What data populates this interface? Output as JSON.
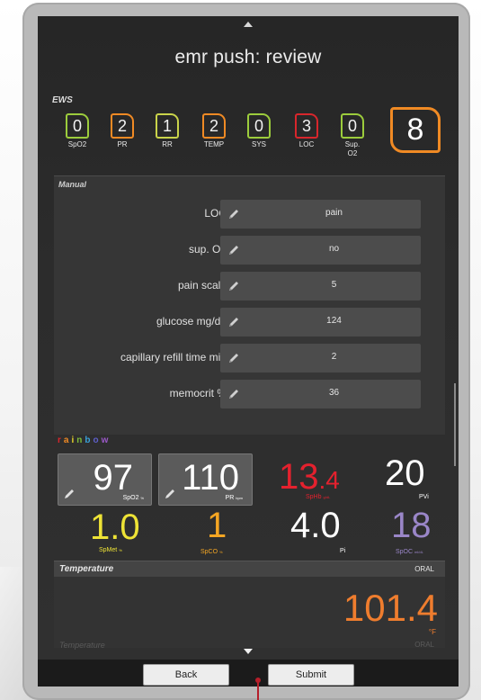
{
  "screen": {
    "title": "emr push: review"
  },
  "ews": {
    "label": "EWS",
    "items": [
      {
        "value": "0",
        "name": "SpO2",
        "color": "#9ccc3c"
      },
      {
        "value": "2",
        "name": "PR",
        "color": "#f08a24"
      },
      {
        "value": "1",
        "name": "RR",
        "color": "#c9d34a"
      },
      {
        "value": "2",
        "name": "TEMP",
        "color": "#f08a24"
      },
      {
        "value": "0",
        "name": "SYS",
        "color": "#9ccc3c"
      },
      {
        "value": "3",
        "name": "LOC",
        "color": "#d8262c"
      },
      {
        "value": "0",
        "name": "Sup.",
        "name2": "O2",
        "color": "#9ccc3c"
      }
    ],
    "total": "8",
    "total_color": "#f08a24"
  },
  "manual": {
    "label": "Manual",
    "rows": [
      {
        "label": "LOC",
        "value": "pain"
      },
      {
        "label": "sup. O2",
        "value": "no"
      },
      {
        "label": "pain scale",
        "value": "5"
      },
      {
        "label": "glucose mg/dL",
        "value": "124"
      },
      {
        "label": "capillary refill time  min",
        "value": "2"
      },
      {
        "label": "memocrit %",
        "value": "36"
      }
    ]
  },
  "rainbow": {
    "letters": [
      "r",
      "a",
      "i",
      "n",
      "b",
      "o",
      "w"
    ],
    "colors": [
      "#d8262c",
      "#f08a24",
      "#e6d32a",
      "#7dbb3a",
      "#3aa0d8",
      "#5e5fc9",
      "#9b59c9"
    ],
    "params": [
      {
        "value": "97",
        "label": "SpO2",
        "unit": "%",
        "color": "#ffffff"
      },
      {
        "value": "110",
        "label": "PR",
        "unit": "bpm",
        "color": "#ffffff"
      },
      {
        "value": "13",
        "decimal": ".4",
        "label": "SpHb",
        "unit": "g/dL",
        "color": "#e4212e"
      },
      {
        "value": "20",
        "label": "PVi",
        "unit": "",
        "color": "#ffffff"
      },
      {
        "value": "1.0",
        "label": "SpMet",
        "unit": "%",
        "color": "#eee336"
      },
      {
        "value": "1",
        "label": "SpCO",
        "unit": "%",
        "color": "#f5a623"
      },
      {
        "value": "4.0",
        "label": "Pi",
        "unit": "",
        "color": "#ffffff"
      },
      {
        "value": "18",
        "label": "SpOC",
        "unit": "ml/dL",
        "color": "#9a86c8"
      }
    ]
  },
  "temperature": {
    "title": "Temperature",
    "site": "ORAL",
    "value": "101.4",
    "unit": "°F",
    "ghost_title": "Temperature",
    "ghost_site": "ORAL"
  },
  "actions": {
    "back_label": "Back",
    "submit_label": "Submit"
  }
}
